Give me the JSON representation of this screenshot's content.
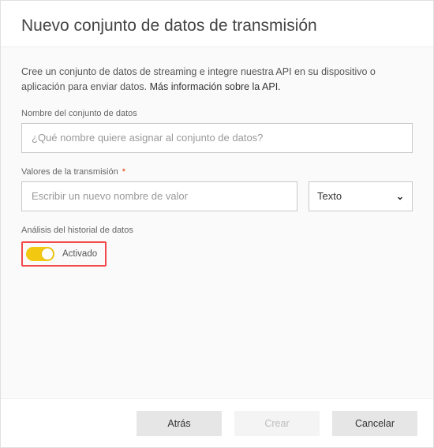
{
  "header": {
    "title": "Nuevo conjunto de datos de transmisión"
  },
  "intro": {
    "text_start": "Cree un conjunto de datos de streaming e integre nuestra API en su dispositivo o aplicación para enviar datos. ",
    "link_text": "Más información sobre la API.",
    "text_end": ""
  },
  "fields": {
    "dataset_name": {
      "label": "Nombre del conjunto de datos",
      "placeholder": "¿Qué nombre quiere asignar al conjunto de datos?",
      "value": ""
    },
    "stream_values": {
      "label": "Valores de la transmisión",
      "required_mark": "*",
      "value_name_placeholder": "Escribir un nuevo nombre de valor",
      "value_name": "",
      "type_selected": "Texto"
    },
    "historical": {
      "label": "Análisis del historial de datos",
      "state_label": "Activado",
      "on": true
    }
  },
  "footer": {
    "back": "Atrás",
    "create": "Crear",
    "cancel": "Cancelar"
  },
  "colors": {
    "accent_yellow": "#f2c811",
    "highlight_red": "#f24a4a"
  }
}
